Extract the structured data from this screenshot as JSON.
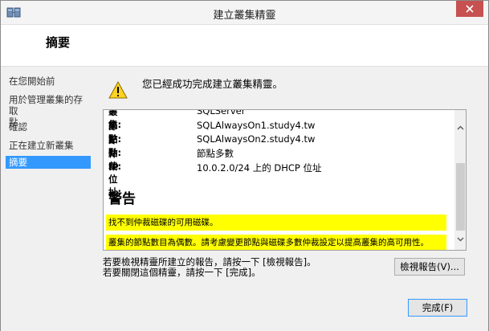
{
  "window": {
    "title": "建立叢集精靈"
  },
  "header": {
    "title": "摘要"
  },
  "nav": {
    "items": [
      {
        "label": "在您開始前",
        "active": false
      },
      {
        "label": "用於管理叢集的存取\n點",
        "active": false
      },
      {
        "label": "確認",
        "active": false
      },
      {
        "label": "正在建立新叢集",
        "active": false
      },
      {
        "label": "摘要",
        "active": true
      }
    ]
  },
  "content": {
    "success_message": "您已經成功完成建立叢集精靈。",
    "report": {
      "rows": [
        {
          "key": "叢集:",
          "value": "SQLServer"
        },
        {
          "key": "節點:",
          "value": "SQLAlwaysOn1.study4.tw"
        },
        {
          "key": "節點:",
          "value": "SQLAlwaysOn2.study4.tw"
        },
        {
          "key": "仲裁:",
          "value": "節點多數"
        },
        {
          "key": "IP 位址:",
          "value": "10.0.2.0/24 上的 DHCP 位址"
        }
      ],
      "warning_heading": "警告",
      "warnings": [
        "找不到仲裁磁碟的可用磁碟。",
        "叢集的節點數目為偶數。請考慮變更節點與磁碟多數仲裁設定以提高叢集的高可用性。"
      ]
    },
    "footer_lines": [
      "若要檢視精靈所建立的報告，請按一下 [檢視報告]。",
      "若要關閉這個精靈，請按一下 [完成]。"
    ],
    "view_report_button": "檢視報告(V)...",
    "finish_button": "完成(F)"
  }
}
